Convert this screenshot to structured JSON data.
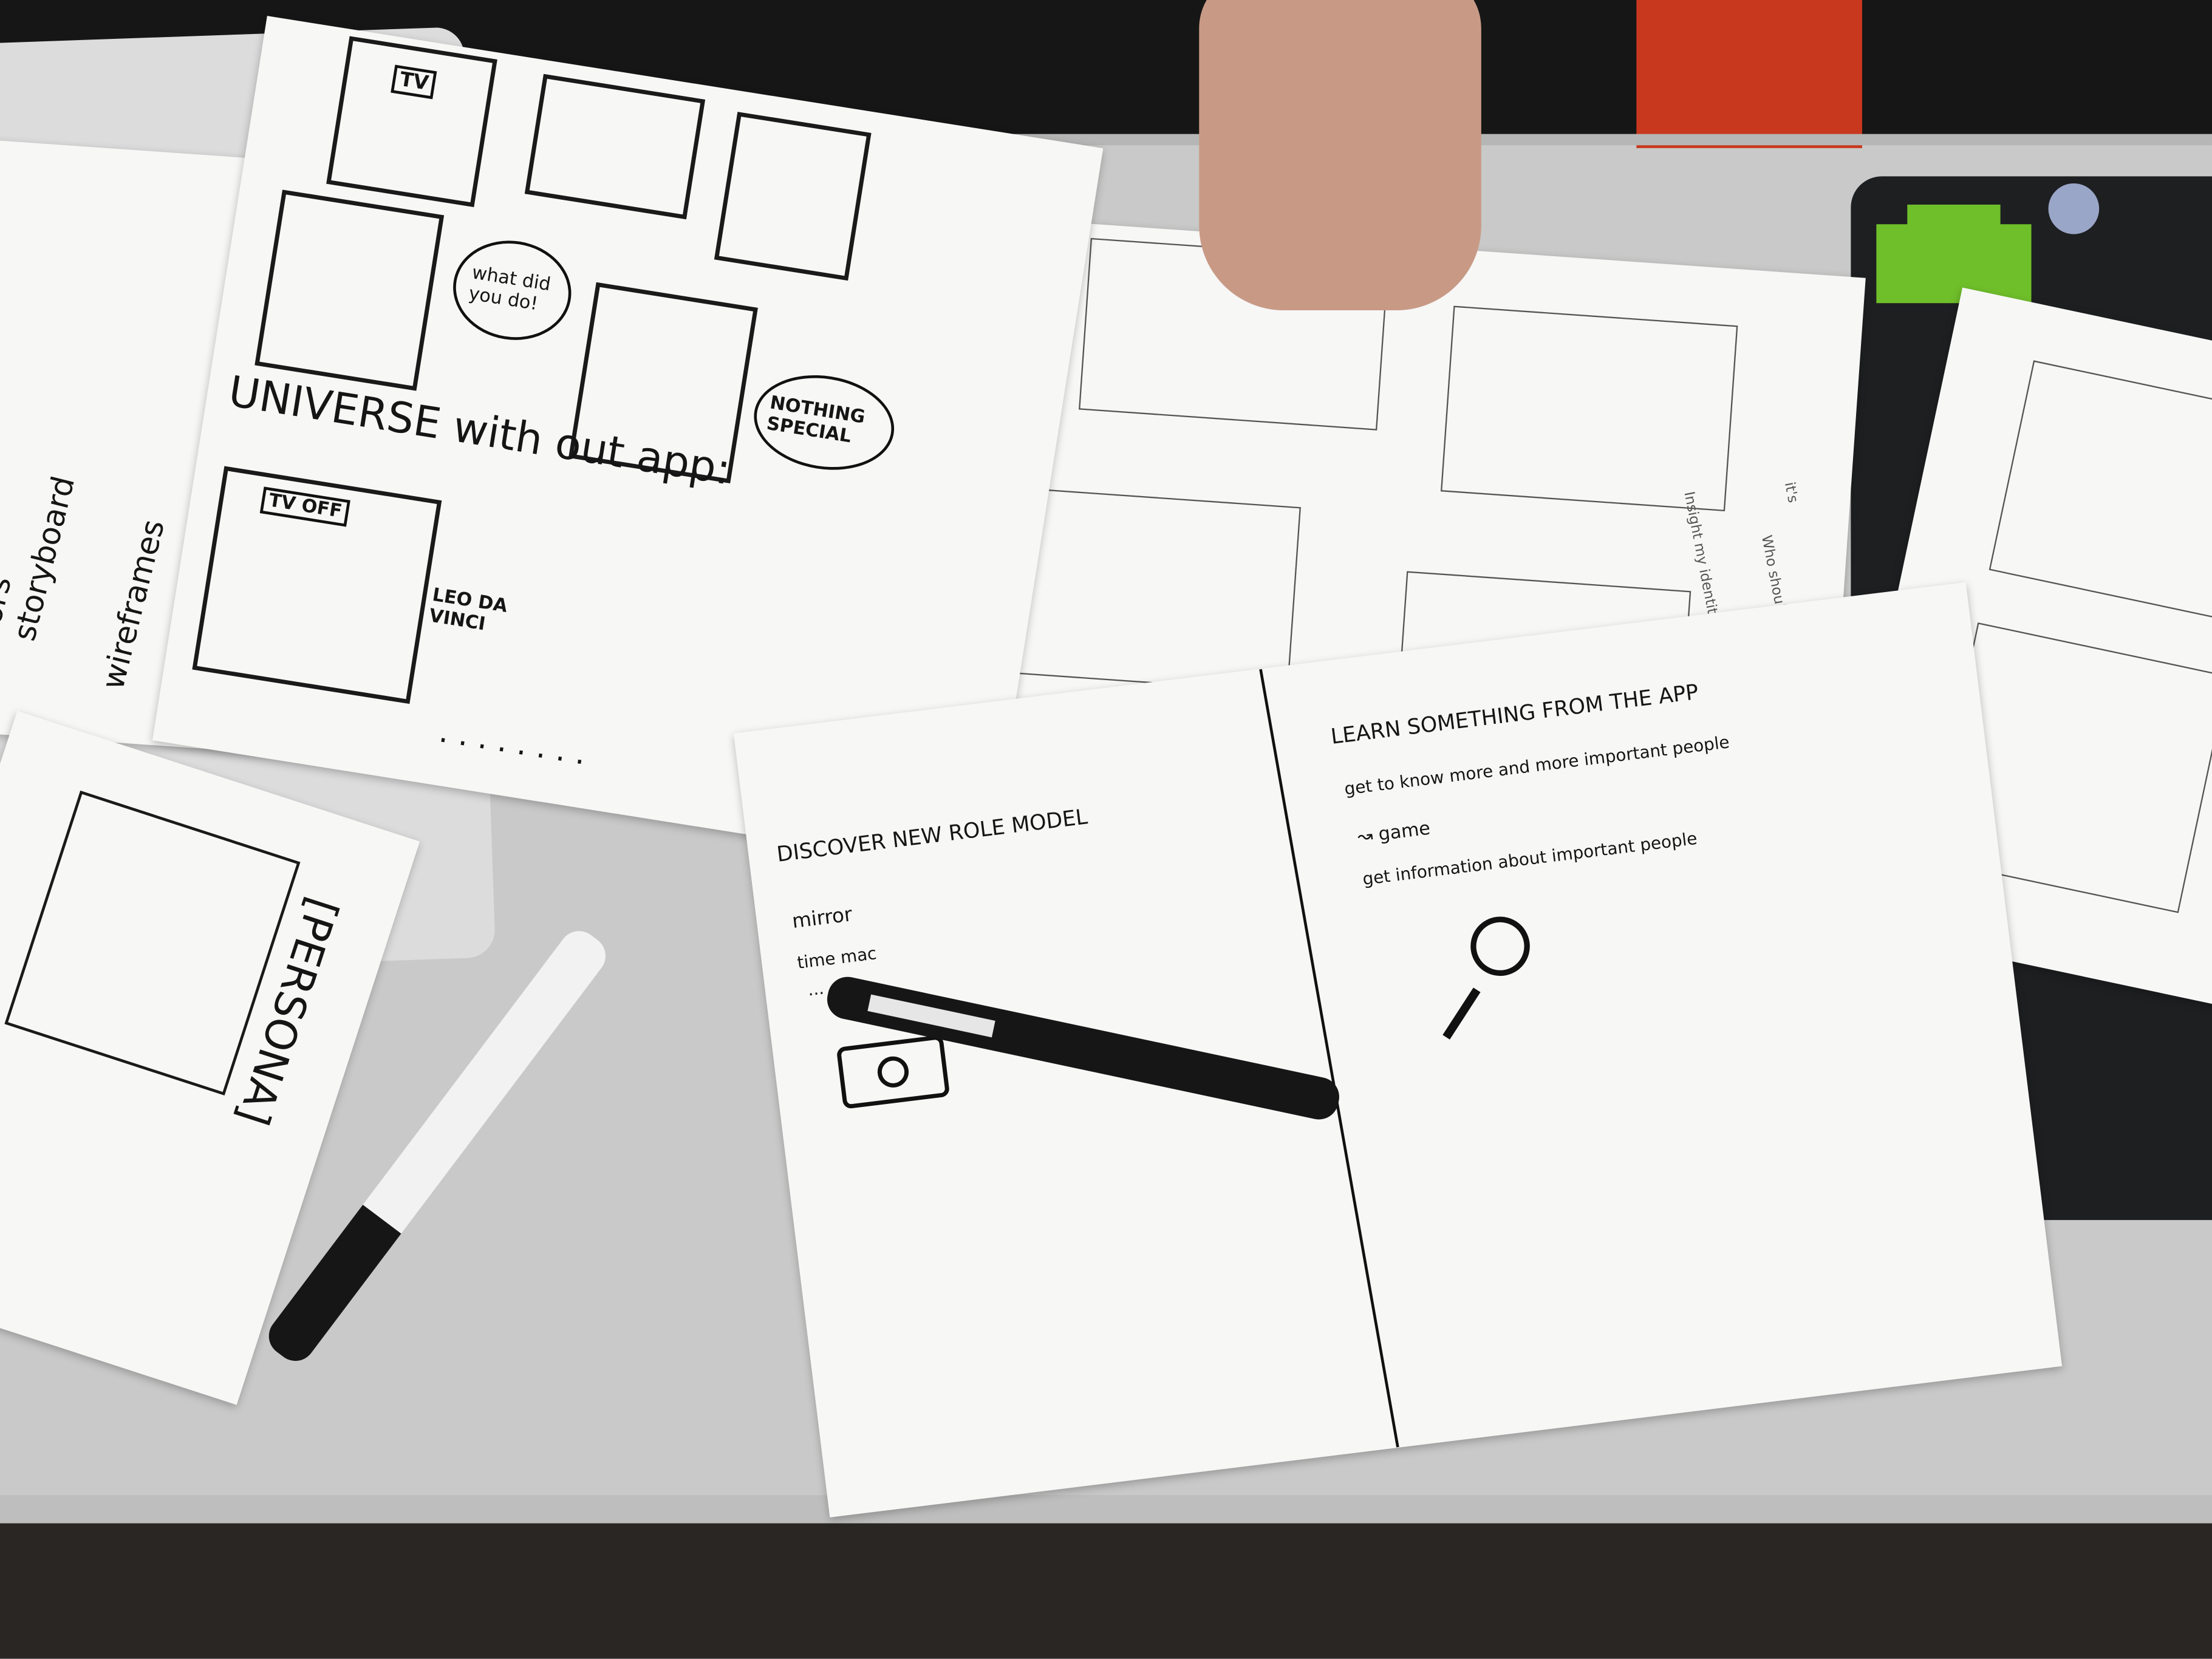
{
  "storyboard_sheet": {
    "tv_label": "TV",
    "speech_1": "what did you do!",
    "speech_2": "NOTHING SPECIAL",
    "heading": "UNIVERSE with out app:",
    "tv_off_label": "TV OFF",
    "character": "LEO DA VINCI",
    "ellipsis": ". . . . . . . ."
  },
  "methods_sheet": {
    "items": [
      "ors",
      "storyboard",
      "wireframes"
    ]
  },
  "persona_sheet": {
    "label": "[PERSONA]"
  },
  "main_sheet": {
    "left_heading": "DISCOVER NEW ROLE MODEL",
    "left_items": [
      "mirror",
      "time mac",
      "..."
    ],
    "right_heading": "LEARN SOMETHING FROM THE APP",
    "right_items": [
      "get to know more and more important people",
      "↝ game",
      "get information about important people"
    ],
    "icons": [
      "camera-icon",
      "magnifier-icon"
    ]
  },
  "pencil_sheet": {
    "notes": [
      "Who should",
      "Insight my identity",
      "it's"
    ]
  },
  "colors": {
    "table": "#c8c9c8",
    "paper": "#f7f7f6",
    "ink": "#151515",
    "laptop_dark": "#1e1f21",
    "chair_red": "#c8381e",
    "sticker_green": "#6fbf2a"
  }
}
